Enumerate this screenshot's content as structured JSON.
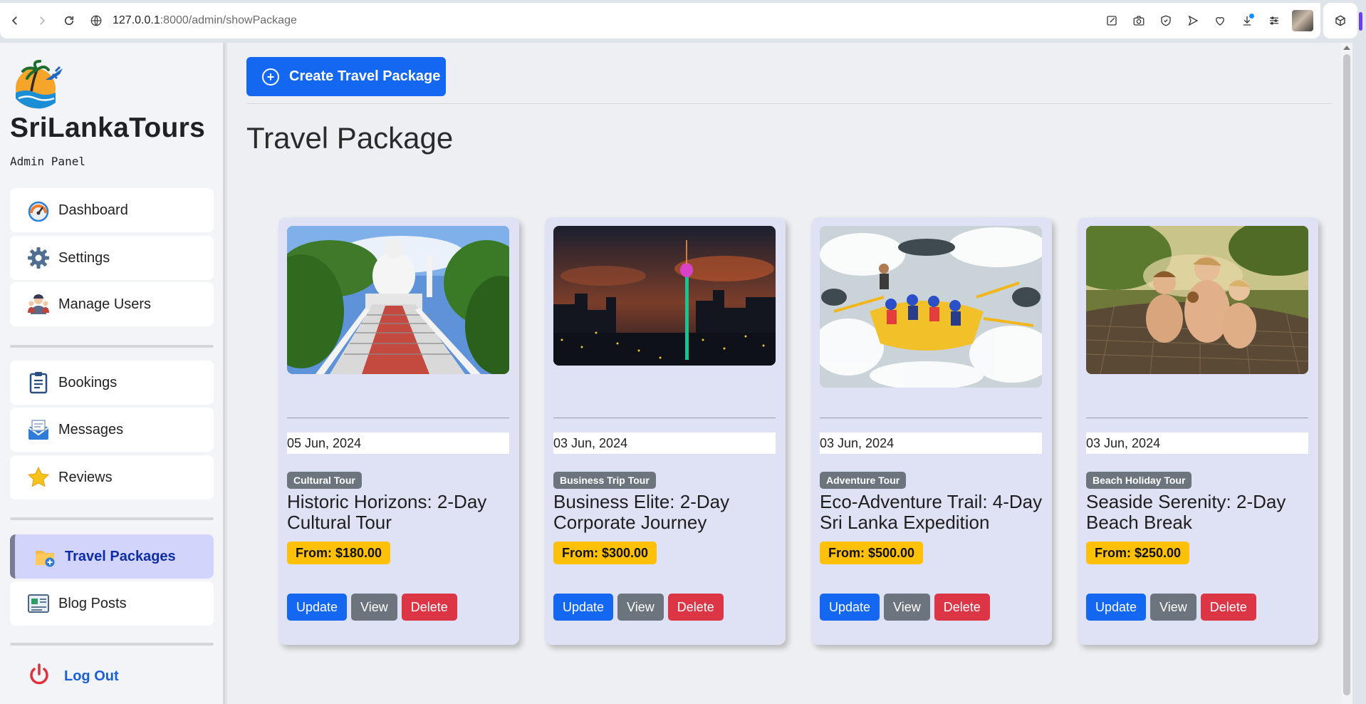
{
  "browser": {
    "url_host": "127.0.0.1",
    "url_path": ":8000/admin/showPackage"
  },
  "sidebar": {
    "brand": "SriLankaTours",
    "subtitle": "Admin Panel",
    "items": [
      {
        "label": "Dashboard",
        "icon": "dashboard-gauge-icon"
      },
      {
        "label": "Settings",
        "icon": "gear-icon"
      },
      {
        "label": "Manage Users",
        "icon": "users-icon"
      },
      {
        "label": "Bookings",
        "icon": "clipboard-icon"
      },
      {
        "label": "Messages",
        "icon": "mail-icon"
      },
      {
        "label": "Reviews",
        "icon": "star-icon"
      },
      {
        "label": "Travel Packages",
        "icon": "package-icon",
        "active": true
      },
      {
        "label": "Blog Posts",
        "icon": "newspaper-icon"
      }
    ],
    "logout": "Log Out"
  },
  "main": {
    "create_button": "Create Travel Package",
    "title": "Travel Package",
    "cards": [
      {
        "date": "05 Jun, 2024",
        "category": "Cultural Tour",
        "title": "Historic Horizons: 2-Day Cultural Tour",
        "price": "From: $180.00"
      },
      {
        "date": "03 Jun, 2024",
        "category": "Business Trip Tour",
        "title": "Business Elite: 2-Day Corporate Journey",
        "price": "From: $300.00"
      },
      {
        "date": "03 Jun, 2024",
        "category": "Adventure Tour",
        "title": "Eco-Adventure Trail: 4-Day Sri Lanka Expedition",
        "price": "From: $500.00"
      },
      {
        "date": "03 Jun, 2024",
        "category": "Beach Holiday Tour",
        "title": "Seaside Serenity: 2-Day Beach Break",
        "price": "From: $250.00"
      }
    ],
    "actions": {
      "update": "Update",
      "view": "View",
      "delete": "Delete"
    }
  },
  "colors": {
    "primary": "#1367f0",
    "secondary": "#6c757d",
    "danger": "#dc3545",
    "warning": "#ffc107",
    "active_nav_bg": "#d3d4fb"
  }
}
